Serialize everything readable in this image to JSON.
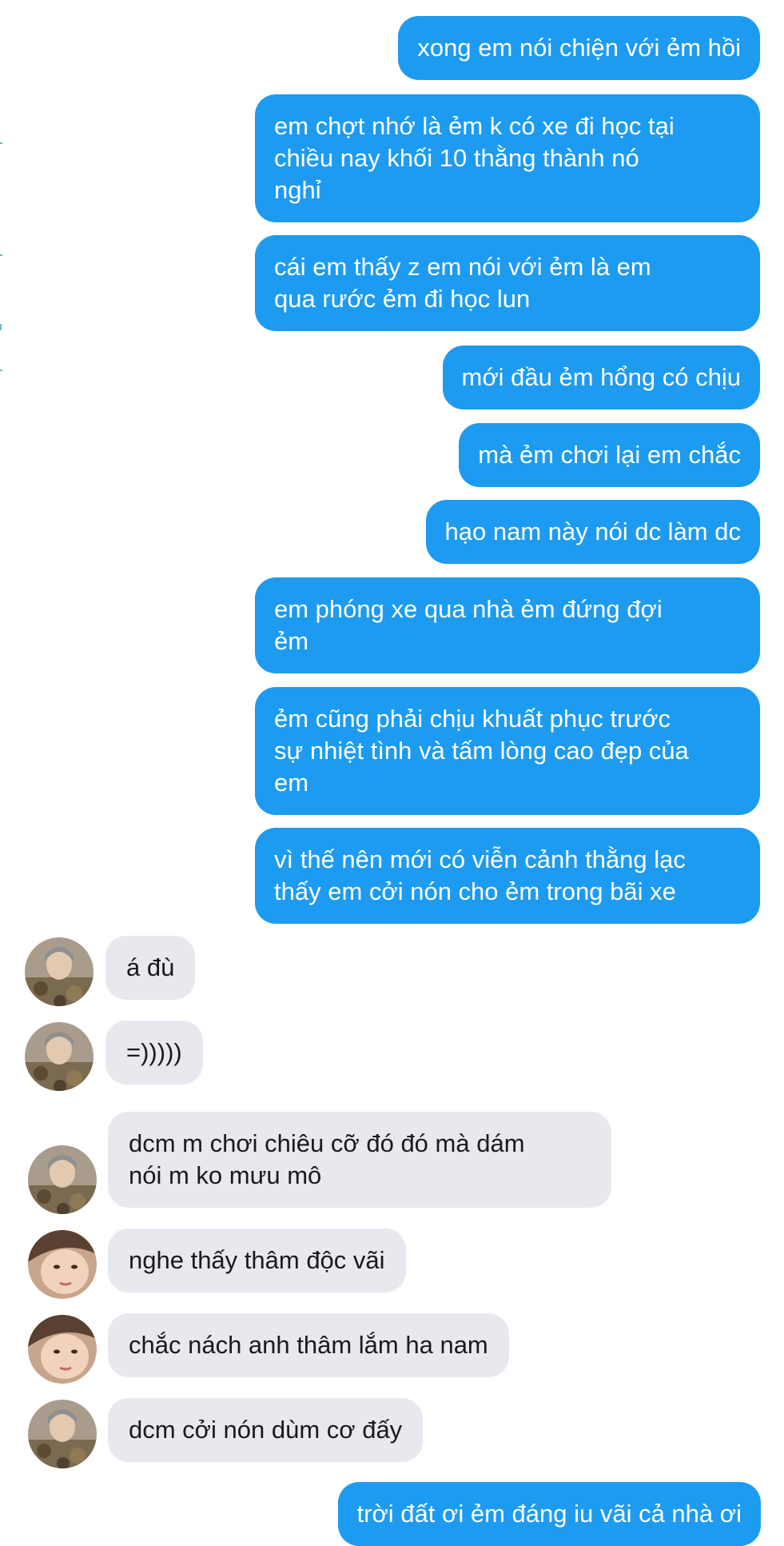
{
  "colors": {
    "outgoing_bubble": "#1d9bf0",
    "incoming_bubble": "#e7e9ee",
    "outgoing_text": "#ffffff",
    "incoming_text": "#1a1a1a"
  },
  "messages": [
    {
      "direction": "outgoing",
      "text": "xong em nói chiện với ẻm hồi"
    },
    {
      "direction": "outgoing",
      "text": "em chợt nhớ là ẻm k có xe đi học tại\nchiều nay khối 10 thằng thành nó\nnghỉ"
    },
    {
      "direction": "outgoing",
      "text": "cái em thấy z em nói với ẻm là em\nqua rước ẻm đi học lun"
    },
    {
      "direction": "outgoing",
      "text": "mới đầu ẻm hổng có chịu"
    },
    {
      "direction": "outgoing",
      "text": "mà ẻm chơi lại em chắc"
    },
    {
      "direction": "outgoing",
      "text": "hạo nam này nói dc làm dc"
    },
    {
      "direction": "outgoing",
      "text": "em phóng xe qua nhà ẻm đứng đợi\nẻm"
    },
    {
      "direction": "outgoing",
      "text": "ẻm cũng phải chịu khuất phục trước\nsự nhiệt tình và tấm lòng cao đẹp của\nem"
    },
    {
      "direction": "outgoing",
      "text": "vì thế nên mới có viễn cảnh thằng lạc\nthấy em cởi nón cho ẻm trong bãi xe"
    },
    {
      "direction": "incoming",
      "avatar": "contact-a",
      "text": "á đù"
    },
    {
      "direction": "incoming",
      "avatar": "contact-a",
      "text": "=)))))"
    },
    {
      "direction": "incoming",
      "avatar": "contact-a",
      "text": "dcm m chơi chiêu cỡ đó đó mà dám\nnói m ko mưu mô"
    },
    {
      "direction": "incoming",
      "avatar": "contact-b",
      "text": "nghe thấy thâm độc vãi"
    },
    {
      "direction": "incoming",
      "avatar": "contact-b",
      "text": "chắc nách anh thâm lắm ha nam"
    },
    {
      "direction": "incoming",
      "avatar": "contact-a",
      "text": "dcm cởi nón dùm cơ đấy"
    },
    {
      "direction": "outgoing",
      "text": "trời đất ơi ẻm đáng iu vãi cả nhà ơi"
    }
  ]
}
